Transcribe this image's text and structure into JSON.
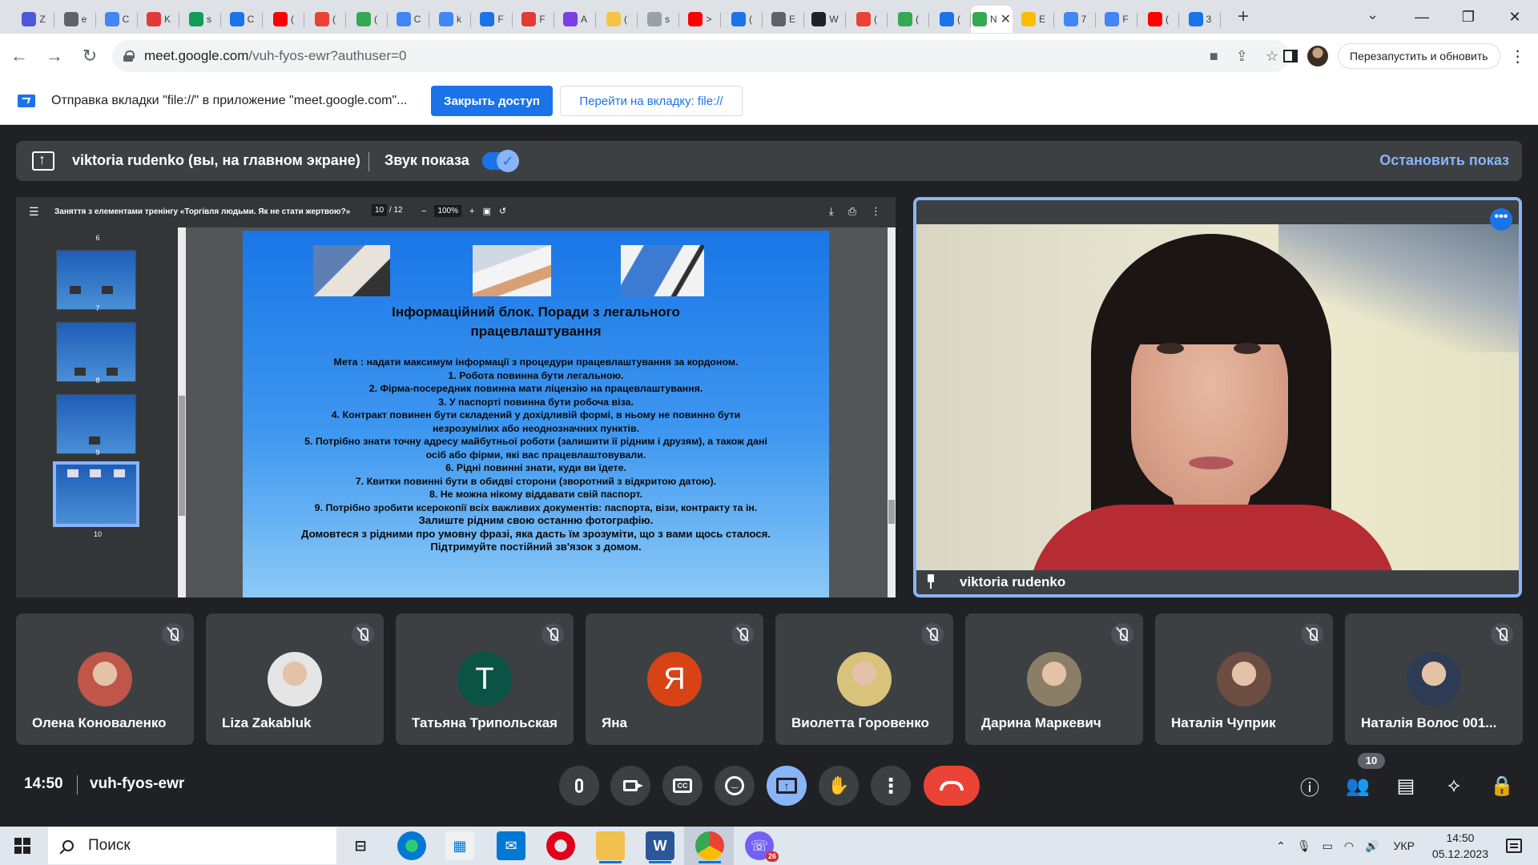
{
  "browser": {
    "tabs": [
      {
        "letter": "Z",
        "color": "#4b5ad7"
      },
      {
        "letter": "e",
        "color": "#5f6368"
      },
      {
        "letter": "C",
        "color": "#4285f4"
      },
      {
        "letter": "K",
        "color": "#e53935"
      },
      {
        "letter": "s",
        "color": "#0f9d58"
      },
      {
        "letter": "C",
        "color": "#1a73e8"
      },
      {
        "letter": "(",
        "color": "#ff0000"
      },
      {
        "letter": "(",
        "color": "#ea4335"
      },
      {
        "letter": "(",
        "color": "#34a853"
      },
      {
        "letter": "C",
        "color": "#4285f4"
      },
      {
        "letter": "k",
        "color": "#4285f4"
      },
      {
        "letter": "F",
        "color": "#1a73e8"
      },
      {
        "letter": "F",
        "color": "#e53935"
      },
      {
        "letter": "A",
        "color": "#7b3fe4"
      },
      {
        "letter": "(",
        "color": "#f4c542"
      },
      {
        "letter": "s",
        "color": "#9aa0a6"
      },
      {
        "letter": ">",
        "color": "#ff0000"
      },
      {
        "letter": "(",
        "color": "#1a73e8"
      },
      {
        "letter": "E",
        "color": "#5f6368"
      },
      {
        "letter": "W",
        "color": "#202124"
      },
      {
        "letter": "(",
        "color": "#ea4335"
      },
      {
        "letter": "(",
        "color": "#34a853"
      },
      {
        "letter": "(",
        "color": "#1a73e8"
      },
      {
        "letter": "N",
        "color": "#ffffff",
        "active": true
      },
      {
        "letter": "E",
        "color": "#fbbc04"
      },
      {
        "letter": "7",
        "color": "#4285f4"
      },
      {
        "letter": "F",
        "color": "#4285f4"
      },
      {
        "letter": "(",
        "color": "#ff0000"
      },
      {
        "letter": "3",
        "color": "#1a73e8"
      }
    ],
    "active_tab_close": "✕",
    "new_tab": "+",
    "tab_search": "⌄",
    "window_controls": {
      "minimize": "—",
      "maximize": "❐",
      "close": "✕"
    },
    "url_host": "meet.google.com",
    "url_path": "/vuh-fyos-ewr?authuser=0",
    "relaunch_label": "Перезапустить и обновить"
  },
  "infobar": {
    "text": "Отправка вкладки \"file://\" в приложение \"meet.google.com\"...",
    "primary_button": "Закрыть доступ",
    "secondary_button": "Перейти на вкладку: file://"
  },
  "presentation": {
    "presenter": "viktoria rudenko (вы, на главном экране)",
    "sound_label": "Звук показа",
    "stop_label": "Остановить показ"
  },
  "pdf": {
    "title": "Заняття з елементами тренінгу «Торгівля людьми. Як не стати жертвою?»",
    "page_current": "10",
    "page_total": "/ 12",
    "zoom": "100%",
    "thumbnails": [
      "6",
      "7",
      "8",
      "9",
      "10"
    ],
    "slide_title_line1": "Інформаційний блок. Поради з легального",
    "slide_title_line2": "працевлаштування",
    "slide_lines": [
      "Мета : надати максимум інформації з  процедури працевлаштування за кордоном.",
      "1. Робота повинна бути легальною.",
      "2. Фірма-посередник повинна мати ліцензію на працевлаштування.",
      "3. У паспорті повинна бути робоча віза.",
      "4. Контракт повинен бути складений у дохідливій формі, в ньому не повинно бути незрозумілих або неоднозначних пунктів.",
      "5. Потрібно знати точну адресу майбутньої роботи (залишити її рідним і друзям), а також дані осіб або фірми, які вас працевлаштовували.",
      "6. Рідні повинні знати, куди ви їдете.",
      "7. Квитки повинні бути в обидві сторони (зворотний з відкритою датою).",
      "8. Не можна нікому віддавати свій паспорт.",
      "9. Потрібно зробити ксерокопії всіх важливих документів: паспорта, візи, контракту та ін.",
      "Залиште рідним свою останню фотографію.",
      "Домовтеся з рідними про умовну фразі, яка дасть їм зрозуміти, що з вами щось сталося.",
      "Підтримуйте постійний зв'язок з домом."
    ]
  },
  "presenter_tile": {
    "name": "viktoria rudenko",
    "more": "•••"
  },
  "participants": [
    {
      "name": "Олена Коноваленко",
      "initial": "",
      "color": "#c0564a"
    },
    {
      "name": "Liza Zakabluk",
      "initial": "",
      "color": "#e5e5e5"
    },
    {
      "name": "Татьяна Трипольская",
      "initial": "T",
      "color": "#0b5345"
    },
    {
      "name": "Яна",
      "initial": "Я",
      "color": "#d84315"
    },
    {
      "name": "Виолетта Горовенко",
      "initial": "",
      "color": "#d9c27a"
    },
    {
      "name": "Дарина Маркевич",
      "initial": "",
      "color": "#8a7f66"
    },
    {
      "name": "Наталія Чуприк",
      "initial": "",
      "color": "#6d4c41"
    },
    {
      "name": "Наталія Волос 001...",
      "initial": "",
      "color": "#2e3b55"
    }
  ],
  "meeting": {
    "time": "14:50",
    "code": "vuh-fyos-ewr",
    "people_count": "10"
  },
  "taskbar": {
    "search_placeholder": "Поиск",
    "viber_badge": "26",
    "language": "УКР",
    "clock_time": "14:50",
    "clock_date": "05.12.2023"
  }
}
